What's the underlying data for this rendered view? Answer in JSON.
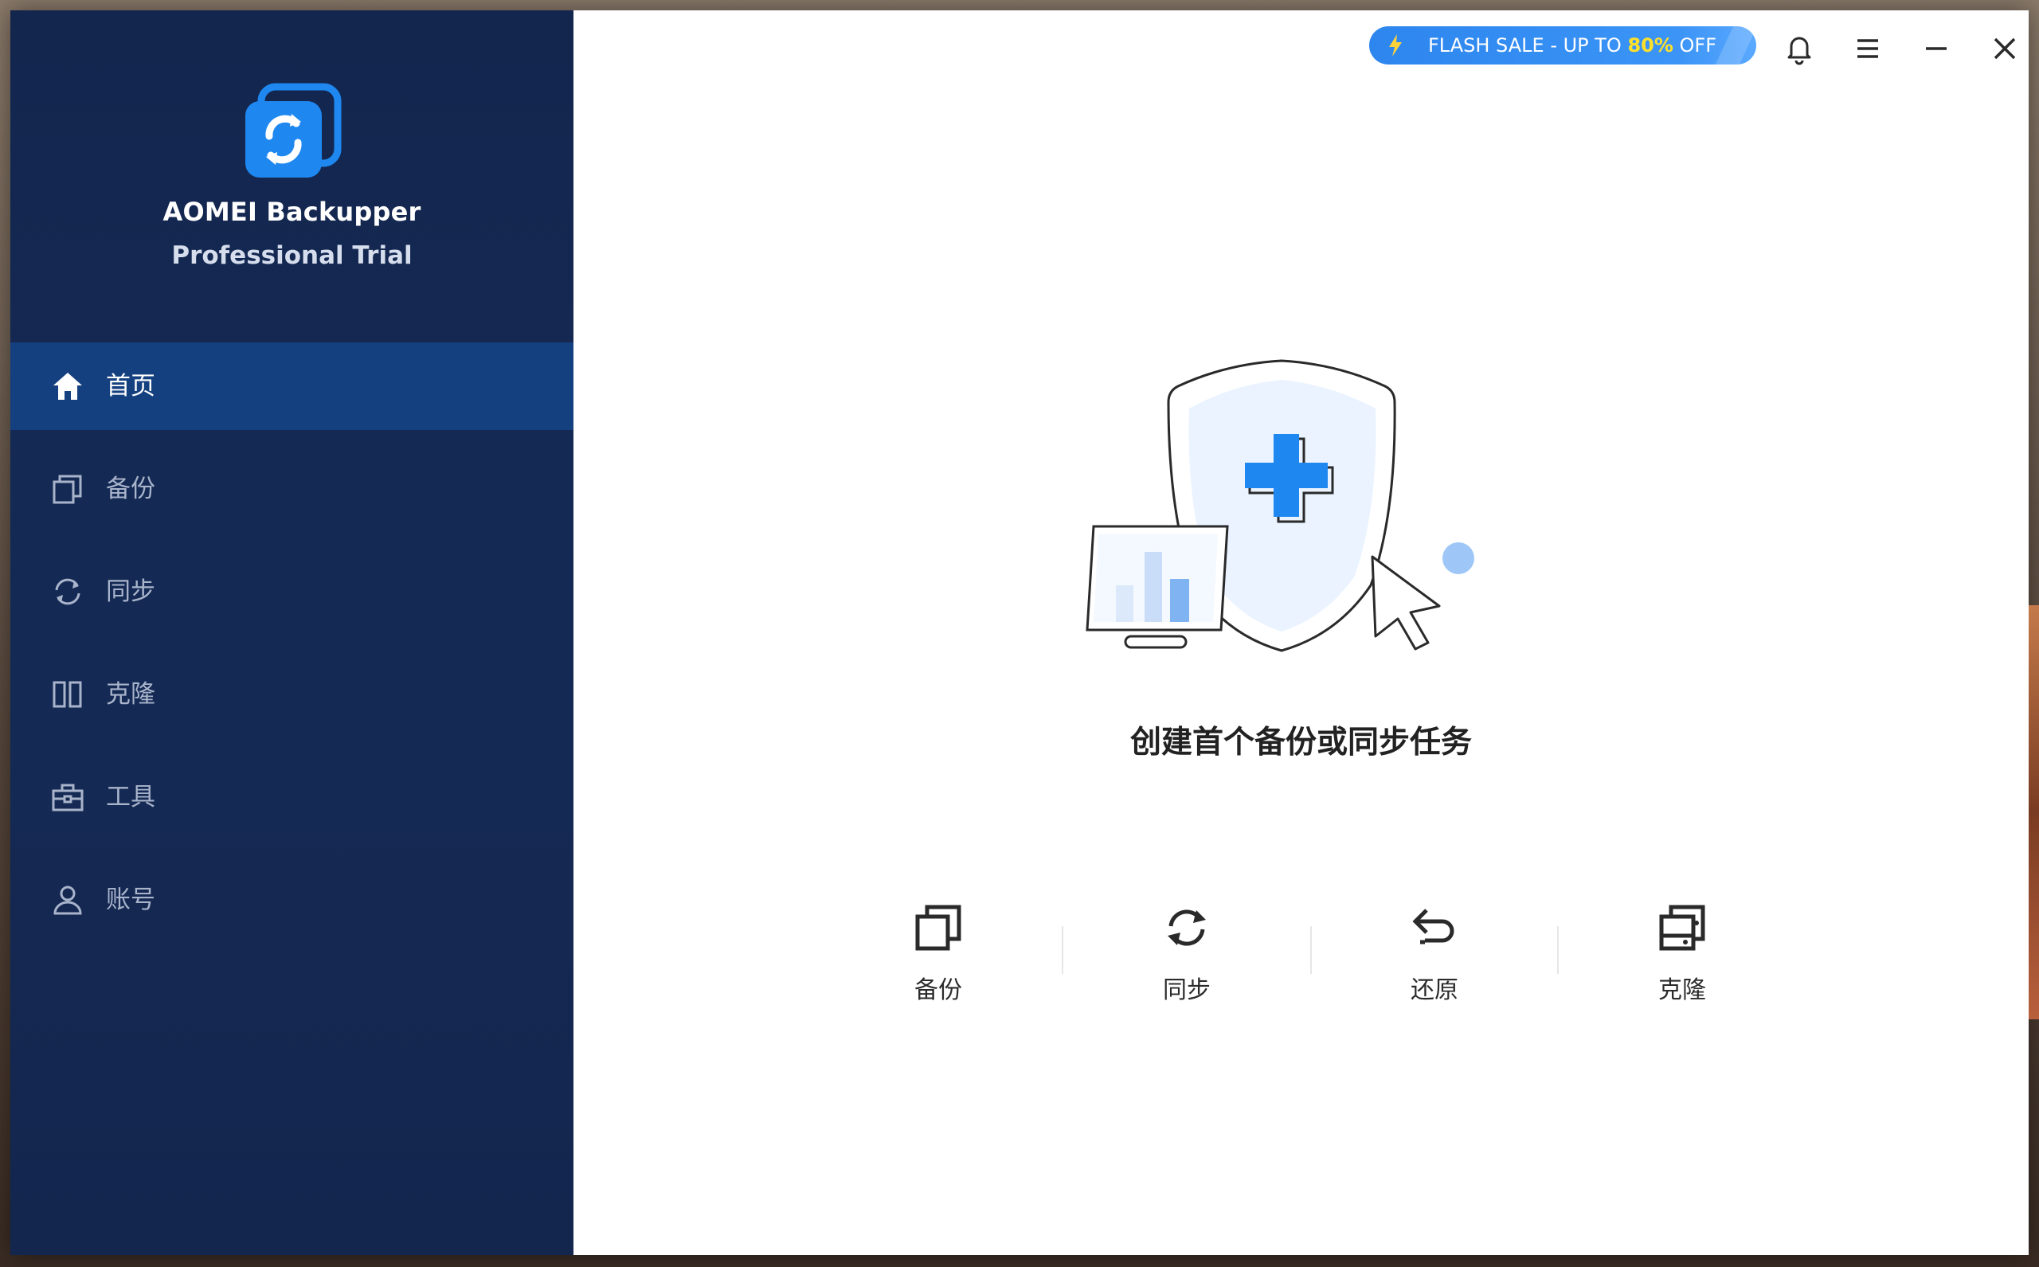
{
  "app": {
    "name": "AOMEI Backupper",
    "edition": "Professional Trial"
  },
  "sidebar": {
    "items": [
      {
        "label": "首页",
        "icon": "home-icon",
        "active": true
      },
      {
        "label": "备份",
        "icon": "backup-icon",
        "active": false
      },
      {
        "label": "同步",
        "icon": "sync-icon",
        "active": false
      },
      {
        "label": "克隆",
        "icon": "clone-icon",
        "active": false
      },
      {
        "label": "工具",
        "icon": "toolbox-icon",
        "active": false
      },
      {
        "label": "账号",
        "icon": "user-icon",
        "active": false
      }
    ]
  },
  "topbar": {
    "promo_prefix": "FLASH SALE - UP TO ",
    "promo_highlight": "80%",
    "promo_suffix": " OFF",
    "icons": [
      "lightning-icon",
      "bell-icon",
      "menu-icon",
      "minimize-icon",
      "close-icon"
    ]
  },
  "main": {
    "headline": "创建首个备份或同步任务",
    "actions": [
      {
        "label": "备份",
        "icon": "backup-icon"
      },
      {
        "label": "同步",
        "icon": "sync-icon"
      },
      {
        "label": "还原",
        "icon": "restore-icon"
      },
      {
        "label": "克隆",
        "icon": "clone-icon"
      }
    ]
  },
  "colors": {
    "sidebar_bg": "#13264e",
    "active_item": "#15407f",
    "accent": "#1e88f0",
    "promo_highlight": "#ffe02a"
  }
}
